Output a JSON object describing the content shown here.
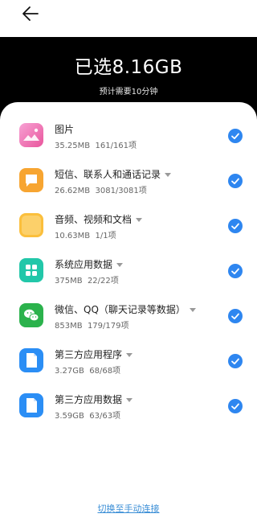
{
  "header": {
    "back_icon": "back-arrow-icon",
    "title": "已选8.16GB",
    "subtitle": "预计需要10分钟"
  },
  "items": [
    {
      "name": "图片",
      "size": "35.25MB",
      "count": "161/161项",
      "icon": "photos-icon",
      "color": "#f06fb0",
      "expandable": false,
      "checked": true
    },
    {
      "name": "短信、联系人和通话记录",
      "size": "26.62MB",
      "count": "3081/3081项",
      "icon": "messages-icon",
      "color": "#f7a531",
      "expandable": true,
      "checked": true
    },
    {
      "name": "音频、视频和文档",
      "size": "10.63MB",
      "count": "1/1项",
      "icon": "folder-icon",
      "color": "#fbbf3c",
      "expandable": true,
      "checked": true
    },
    {
      "name": "系统应用数据",
      "size": "375MB",
      "count": "22/22项",
      "icon": "system-apps-icon",
      "color": "#22c7a9",
      "expandable": true,
      "checked": true
    },
    {
      "name": "微信、QQ（聊天记录等数据）",
      "size": "853MB",
      "count": "179/179项",
      "icon": "wechat-icon",
      "color": "#2bb24c",
      "expandable": true,
      "checked": true
    },
    {
      "name": "第三方应用程序",
      "size": "3.27GB",
      "count": "68/68项",
      "icon": "file-icon",
      "color": "#2b8ef5",
      "expandable": true,
      "checked": true
    },
    {
      "name": "第三方应用数据",
      "size": "3.59GB",
      "count": "63/63项",
      "icon": "file-icon",
      "color": "#2b8ef5",
      "expandable": true,
      "checked": true
    }
  ],
  "footer": {
    "link_label": "切换至手动连接"
  },
  "colors": {
    "accent": "#2e86f0",
    "link": "#3a8ed6",
    "header_bg": "#000000"
  }
}
